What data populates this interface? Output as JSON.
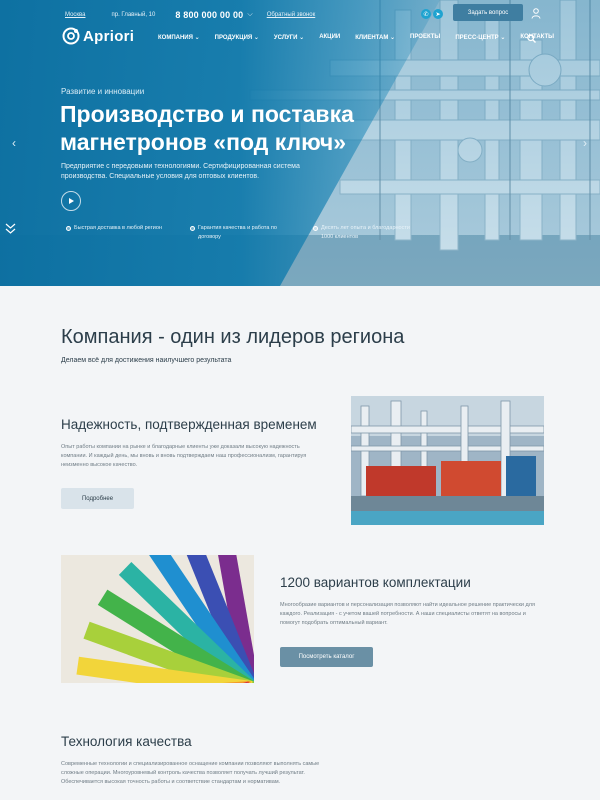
{
  "topbar": {
    "city": "Москва",
    "address": "пр. Главный, 10",
    "phone": "8 800 000 00 00",
    "callback": "Обратный звонок",
    "ask_button": "Задать вопрос"
  },
  "logo": {
    "text": "Apriori"
  },
  "nav": {
    "items": [
      "КОМПАНИЯ ⌄",
      "ПРОДУКЦИЯ ⌄",
      "УСЛУГИ ⌄",
      "АКЦИИ",
      "КЛИЕНТАМ ⌄",
      "ПРОЕКТЫ",
      "ПРЕСС-ЦЕНТР ⌄",
      "КОНТАКТЫ"
    ]
  },
  "hero": {
    "kicker": "Развитие и инновации",
    "title": "Производство и поставка магнетронов «под ключ»",
    "description": "Предприятие с передовыми технологиями. Сертифицированная система производства. Специальные условия для оптовых клиентов.",
    "features": [
      "Быстрая доставка в любой регион",
      "Гарантия качества и работа по договору",
      "Десять лет опыта и благодарности 1000 клиентов"
    ]
  },
  "company": {
    "heading": "Компания - один из лидеров региона",
    "lead": "Делаем всё для достижения наилучшего результата"
  },
  "block1": {
    "heading": "Надежность, подтвержденная временем",
    "text": "Опыт работы компании на рынке и благодарные клиенты уже доказали высокую надежность компании. И каждый день, мы вновь и вновь подтверждаем наш профессионализм, гарантируя неизменно высокое качество.",
    "button": "Подробнее"
  },
  "block2": {
    "heading": "1200 вариантов комплектации",
    "text": "Многообразие вариантов и персонализация позволяют найти идеальное решение практически для каждого. Реализация - с учетом вашей потребности. А наши специалисты ответят на вопросы и помогут подобрать оптимальный вариант.",
    "button": "Посмотреть каталог"
  },
  "block3": {
    "heading": "Технология качества",
    "text": "Современные технологии и специализированное оснащение компании позволяют выполнять самые сложные операции. Многоуровневый контроль качества позволяет получать лучший результат. Обеспечивается высокая точность работы и соответствие стандартам и нормативам."
  },
  "colors": {
    "accent": "#0e78aa",
    "button_dark": "#6a90a5",
    "button_light": "#d9e3ea",
    "text_dark": "#2c3e4a"
  }
}
